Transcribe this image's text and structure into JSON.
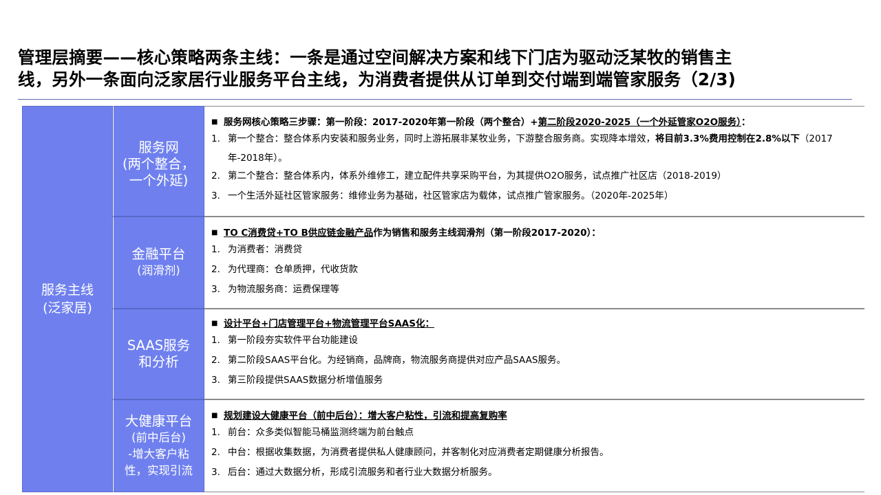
{
  "title": {
    "line1": "管理层摘要——核心策略两条主线：一条是通过空间解决方案和线下门店为驱动泛某牧的销售主",
    "line2": "线，另外一条面向泛家居行业服务平台主线，为消费者提供从订单到交付端到端管家服务（2/3)"
  },
  "main": {
    "line1": "服务主线",
    "line2": "(泛家居)"
  },
  "sections": [
    {
      "label": {
        "line1": "服务网",
        "line2": "(两个整合，",
        "line3": "一个外延)"
      },
      "heading": {
        "part1": "服务网核心策略三步骤：第一阶段：2017-2020年第一阶段（两个整合）+",
        "part2": "第二阶段2020-2025（一个外延管家O2O服务）",
        "part3": "："
      },
      "items": [
        {
          "num": "1.",
          "text": "第一个整合：整合体系内安装和服务业务，同时上游拓展非某牧业务，下游整合服务商。实现降本增效，",
          "bold": "将目前3.3%费用控制在2.8%以下",
          "tail": "（2017年-2018年）。"
        },
        {
          "num": "2.",
          "text": "第二个整合：整合体系内，体系外维修工，建立配件共享采购平台，为其提供O2O服务，试点推广社区店（2018-2019）"
        },
        {
          "num": "3.",
          "text": "一个生活外延社区管家服务：维修业务为基础，社区管家店为载体，试点推广管家服务。（2020年-2025年）"
        }
      ]
    },
    {
      "label": {
        "line1": "金融平台",
        "line2": "(润滑剂)"
      },
      "heading": {
        "part1": "TO C消费贷+TO B供应链金融产品",
        "part2": "作为销售和服务主线润滑剂（第一阶段2017-2020）："
      },
      "items": [
        {
          "num": "1.",
          "text": "为消费者：消费贷"
        },
        {
          "num": "2.",
          "text": "为代理商：仓单质押，代收货款"
        },
        {
          "num": "3.",
          "text": "为物流服务商：运费保理等"
        }
      ]
    },
    {
      "label": {
        "line1": "SAAS服务",
        "line2": "和分析"
      },
      "heading": {
        "part1": "设计平台+门店管理平台+物流管理平台SAAS化："
      },
      "items": [
        {
          "num": "1.",
          "text": "第一阶段夯实软件平台功能建设"
        },
        {
          "num": "2.",
          "text": "第二阶段SAAS平台化。为经销商，品牌商，物流服务商提供对应产品SAAS服务。"
        },
        {
          "num": "3.",
          "text": "第三阶段提供SAAS数据分析增值服务"
        }
      ]
    },
    {
      "label": {
        "line1": "大健康平台",
        "line2": "(前中后台)",
        "line3": "-增大客户粘",
        "line4": "性，实现引流"
      },
      "heading": {
        "part1": "规划建设大健康平台（前中后台）：增大客户粘性，引流和提高复购率"
      },
      "items": [
        {
          "num": "1.",
          "text": "前台：众多类似智能马桶监测终端为前台触点"
        },
        {
          "num": "2.",
          "text": "中台：根据收集数据，为消费者提供私人健康顾问，并客制化对应消费者定期健康分析报告。"
        },
        {
          "num": "3.",
          "text": "后台：通过大数据分析，形成引流服务和者行业大数据分析服务。"
        }
      ]
    }
  ]
}
